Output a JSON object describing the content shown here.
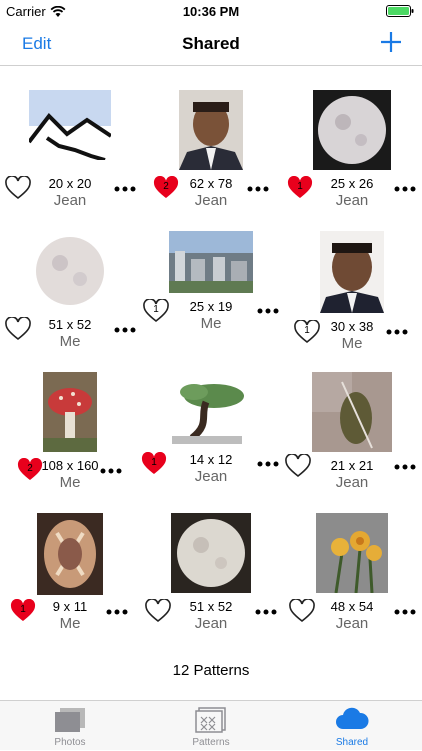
{
  "status_bar": {
    "carrier": "Carrier",
    "time": "10:36 PM"
  },
  "nav": {
    "edit_label": "Edit",
    "title": "Shared"
  },
  "patterns": [
    {
      "dims": "20 x 20",
      "owner": "Jean",
      "likes": "",
      "liked": false
    },
    {
      "dims": "62 x 78",
      "owner": "Jean",
      "likes": "2",
      "liked": true
    },
    {
      "dims": "25 x 26",
      "owner": "Jean",
      "likes": "1",
      "liked": true
    },
    {
      "dims": "51 x 52",
      "owner": "Me",
      "likes": "",
      "liked": false
    },
    {
      "dims": "25 x 19",
      "owner": "Me",
      "likes": "1",
      "liked": false
    },
    {
      "dims": "30 x 38",
      "owner": "Me",
      "likes": "1",
      "liked": false
    },
    {
      "dims": "108 x 160",
      "owner": "Me",
      "likes": "2",
      "liked": true
    },
    {
      "dims": "14 x 12",
      "owner": "Jean",
      "likes": "1",
      "liked": true
    },
    {
      "dims": "21 x 21",
      "owner": "Jean",
      "likes": "",
      "liked": false
    },
    {
      "dims": "9 x 11",
      "owner": "Me",
      "likes": "1",
      "liked": true
    },
    {
      "dims": "51 x 52",
      "owner": "Jean",
      "likes": "",
      "liked": false
    },
    {
      "dims": "48 x 54",
      "owner": "Jean",
      "likes": "",
      "liked": false
    }
  ],
  "footer": {
    "count": "12 Patterns"
  },
  "tabs": [
    {
      "label": "Photos",
      "active": false
    },
    {
      "label": "Patterns",
      "active": false
    },
    {
      "label": "Shared",
      "active": true
    }
  ],
  "colors": {
    "accent": "#1a7ae5",
    "heart_red": "#e8001c"
  }
}
